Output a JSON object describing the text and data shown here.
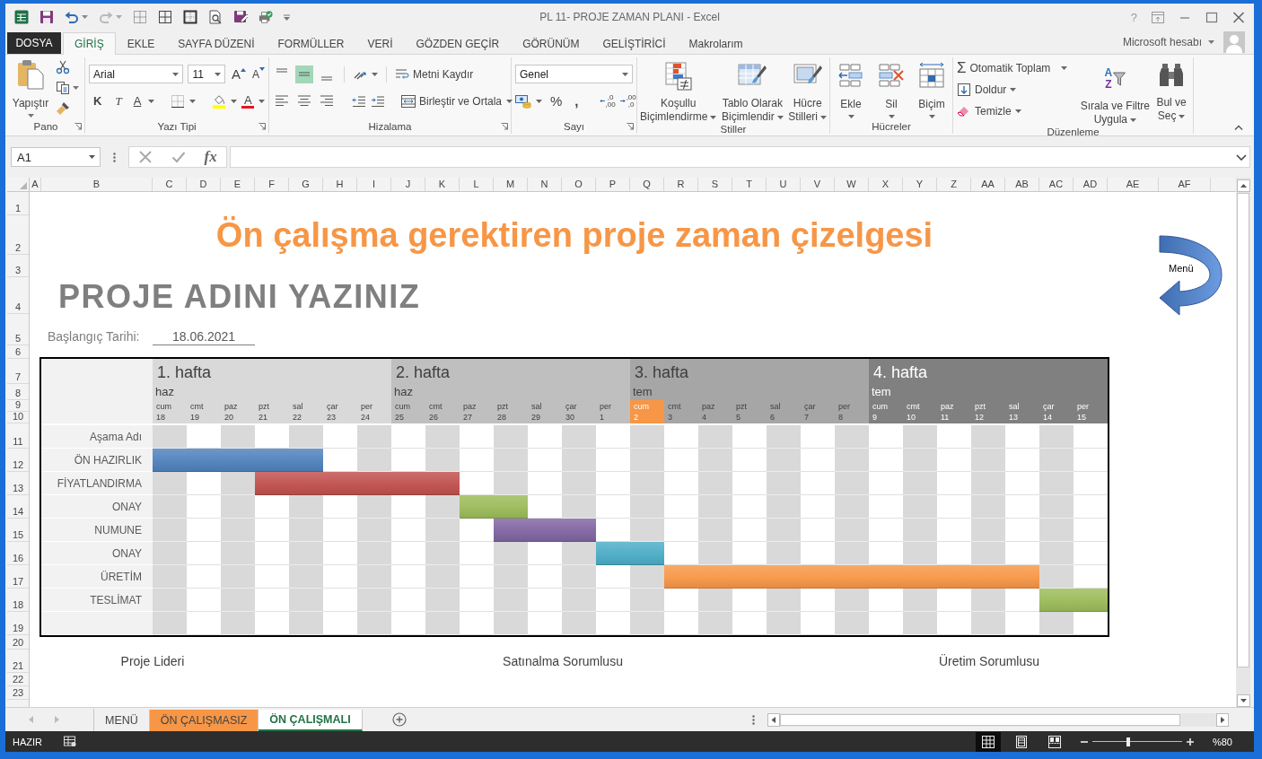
{
  "window": {
    "title": "PL 11- PROJE ZAMAN PLANI - Excel",
    "help": "?"
  },
  "quick_access": {
    "undo": {
      "disabled": false
    },
    "redo": {
      "disabled": true
    }
  },
  "file_tab": "DOSYA",
  "tabs": [
    {
      "label": "GİRİŞ",
      "selected": true
    },
    {
      "label": "EKLE",
      "selected": false
    },
    {
      "label": "SAYFA DÜZENİ",
      "selected": false
    },
    {
      "label": "FORMÜLLER",
      "selected": false
    },
    {
      "label": "VERİ",
      "selected": false
    },
    {
      "label": "GÖZDEN GEÇİR",
      "selected": false
    },
    {
      "label": "GÖRÜNÜM",
      "selected": false
    },
    {
      "label": "GELİŞTİRİCİ",
      "selected": false
    },
    {
      "label": "Makrolarım",
      "selected": false
    }
  ],
  "account": {
    "label": "Microsoft hesabı"
  },
  "ribbon": {
    "clipboard": {
      "paste": "Yapıştır",
      "group": "Pano"
    },
    "font": {
      "name": "Arial",
      "size": "11",
      "grow": "A",
      "shrink": "A",
      "bold": "K",
      "italic": "T",
      "underline": "A",
      "font_color": "A",
      "group": "Yazı Tipi"
    },
    "alignment": {
      "vertical": [
        {
          "selected": false
        },
        {
          "selected": true
        },
        {
          "selected": false
        }
      ],
      "horizontal": [
        {
          "selected": false
        },
        {
          "selected": false
        },
        {
          "selected": false
        }
      ],
      "wrap": "Metni Kaydır",
      "merge": "Birleştir ve Ortala",
      "group": "Hizalama"
    },
    "number": {
      "format": "Genel",
      "percent": "%",
      "comma": ",",
      "decimals": [
        {
          "upper": ",0",
          "lower": ",00"
        },
        {
          "upper": ",00",
          "lower": ",0"
        }
      ],
      "group": "Sayı"
    },
    "styles": {
      "buttons": [
        {
          "lines": [
            "Koşullu",
            "Biçimlendirme"
          ]
        },
        {
          "lines": [
            "Tablo Olarak",
            "Biçimlendir"
          ]
        },
        {
          "lines": [
            "Hücre",
            "Stilleri"
          ]
        }
      ],
      "group": "Stiller"
    },
    "cells": {
      "buttons": [
        "Ekle",
        "Sil",
        "Biçim"
      ],
      "group": "Hücreler"
    },
    "editing": {
      "autosum_symbol": "Σ",
      "autosum": "Otomatik Toplam",
      "fill": "Doldur",
      "clear": "Temizle",
      "sort": {
        "letters": [
          "A",
          "Z"
        ],
        "lines": [
          "Sırala ve Filtre",
          "Uygula"
        ]
      },
      "find": {
        "lines": [
          "Bul ve",
          "Seç"
        ]
      },
      "group": "Düzenleme"
    }
  },
  "formula_bar": {
    "name_box": "A1",
    "fx": "fx"
  },
  "columns": [
    "A",
    "B",
    "C",
    "D",
    "E",
    "F",
    "G",
    "H",
    "I",
    "J",
    "K",
    "L",
    "M",
    "N",
    "O",
    "P",
    "Q",
    "R",
    "S",
    "T",
    "U",
    "V",
    "W",
    "X",
    "Y",
    "Z",
    "AA",
    "AB",
    "AC",
    "AD",
    "AE",
    "AF"
  ],
  "rows": [
    "1",
    "2",
    "3",
    "4",
    "5",
    "6",
    "7",
    "8",
    "9",
    "10",
    "11",
    "12",
    "13",
    "14",
    "15",
    "16",
    "17",
    "18",
    "19",
    "20",
    "21",
    "22",
    "23"
  ],
  "sheet": {
    "title": "Ön çalışma gerektiren proje zaman çizelgesi",
    "menu_button": "Menü",
    "project": "PROJE ADINI YAZINIZ",
    "start_label": "Başlangıç Tarihi:",
    "start_date": "18.06.2021",
    "gantt": {
      "weeks": [
        {
          "label": "1. hafta",
          "month": "haz",
          "color": "#d9d9d9",
          "days": [
            {
              "name": "cum",
              "date": "18",
              "today": false
            },
            {
              "name": "cmt",
              "date": "19",
              "today": false
            },
            {
              "name": "paz",
              "date": "20",
              "today": false
            },
            {
              "name": "pzt",
              "date": "21",
              "today": false
            },
            {
              "name": "sal",
              "date": "22",
              "today": false
            },
            {
              "name": "çar",
              "date": "23",
              "today": false
            },
            {
              "name": "per",
              "date": "24",
              "today": false
            }
          ]
        },
        {
          "label": "2. hafta",
          "month": "haz",
          "color": "#bfbfbf",
          "days": [
            {
              "name": "cum",
              "date": "25",
              "today": false
            },
            {
              "name": "cmt",
              "date": "26",
              "today": false
            },
            {
              "name": "paz",
              "date": "27",
              "today": false
            },
            {
              "name": "pzt",
              "date": "28",
              "today": false
            },
            {
              "name": "sal",
              "date": "29",
              "today": false
            },
            {
              "name": "çar",
              "date": "30",
              "today": false
            },
            {
              "name": "per",
              "date": "1",
              "today": false
            }
          ]
        },
        {
          "label": "3. hafta",
          "month": "tem",
          "color": "#a6a6a6",
          "days": [
            {
              "name": "cum",
              "date": "2",
              "today": true
            },
            {
              "name": "cmt",
              "date": "3",
              "today": false
            },
            {
              "name": "paz",
              "date": "4",
              "today": false
            },
            {
              "name": "pzt",
              "date": "5",
              "today": false
            },
            {
              "name": "sal",
              "date": "6",
              "today": false
            },
            {
              "name": "çar",
              "date": "7",
              "today": false
            },
            {
              "name": "per",
              "date": "8",
              "today": false
            }
          ]
        },
        {
          "label": "4. hafta",
          "month": "tem",
          "color": "#808080",
          "days": [
            {
              "name": "cum",
              "date": "9",
              "today": false
            },
            {
              "name": "cmt",
              "date": "10",
              "today": false
            },
            {
              "name": "paz",
              "date": "11",
              "today": false
            },
            {
              "name": "pzt",
              "date": "12",
              "today": false
            },
            {
              "name": "sal",
              "date": "13",
              "today": false
            },
            {
              "name": "çar",
              "date": "14",
              "today": false
            },
            {
              "name": "per",
              "date": "15",
              "today": false
            }
          ]
        }
      ],
      "label_header": "Aşama Adı",
      "tasks": [
        {
          "name": "ÖN HAZIRLIK",
          "color": "#4f81bd",
          "schedule": [
            true,
            true,
            true,
            true,
            true,
            false,
            false,
            false,
            false,
            false,
            false,
            false,
            false,
            false,
            false,
            false,
            false,
            false,
            false,
            false,
            false,
            false,
            false,
            false,
            false,
            false,
            false,
            false
          ]
        },
        {
          "name": "FİYATLANDIRMA",
          "color": "#c0504d",
          "schedule": [
            false,
            false,
            false,
            true,
            true,
            true,
            true,
            true,
            true,
            false,
            false,
            false,
            false,
            false,
            false,
            false,
            false,
            false,
            false,
            false,
            false,
            false,
            false,
            false,
            false,
            false,
            false,
            false
          ]
        },
        {
          "name": "ONAY",
          "color": "#9bbb59",
          "schedule": [
            false,
            false,
            false,
            false,
            false,
            false,
            false,
            false,
            false,
            true,
            true,
            false,
            false,
            false,
            false,
            false,
            false,
            false,
            false,
            false,
            false,
            false,
            false,
            false,
            false,
            false,
            false,
            false
          ]
        },
        {
          "name": "NUMUNE",
          "color": "#8064a2",
          "schedule": [
            false,
            false,
            false,
            false,
            false,
            false,
            false,
            false,
            false,
            false,
            true,
            true,
            true,
            false,
            false,
            false,
            false,
            false,
            false,
            false,
            false,
            false,
            false,
            false,
            false,
            false,
            false,
            false
          ]
        },
        {
          "name": "ONAY",
          "color": "#4bacc6",
          "schedule": [
            false,
            false,
            false,
            false,
            false,
            false,
            false,
            false,
            false,
            false,
            false,
            false,
            false,
            true,
            true,
            false,
            false,
            false,
            false,
            false,
            false,
            false,
            false,
            false,
            false,
            false,
            false,
            false
          ]
        },
        {
          "name": "ÜRETİM",
          "color": "#f79646",
          "schedule": [
            false,
            false,
            false,
            false,
            false,
            false,
            false,
            false,
            false,
            false,
            false,
            false,
            false,
            false,
            false,
            true,
            true,
            true,
            true,
            true,
            true,
            true,
            true,
            true,
            true,
            true,
            false,
            false
          ]
        },
        {
          "name": "TESLİMAT",
          "color": "#9bbb59",
          "schedule": [
            false,
            false,
            false,
            false,
            false,
            false,
            false,
            false,
            false,
            false,
            false,
            false,
            false,
            false,
            false,
            false,
            false,
            false,
            false,
            false,
            false,
            false,
            false,
            false,
            false,
            false,
            true,
            true
          ]
        }
      ]
    },
    "signatures": [
      "Proje Lideri",
      "Satınalma Sorumlusu",
      "Üretim Sorumlusu"
    ]
  },
  "sheet_tabs": [
    {
      "label": "MENÜ",
      "selected": false
    },
    {
      "label": "ÖN ÇALIŞMASIZ",
      "selected": false,
      "color": "#f79646"
    },
    {
      "label": "ÖN ÇALIŞMALI",
      "selected": true
    }
  ],
  "status_bar": {
    "status": "HAZIR",
    "views": [
      {
        "selected": true
      },
      {
        "selected": false
      },
      {
        "selected": false
      }
    ],
    "zoom": {
      "level": 0.4,
      "reading": "%80"
    }
  }
}
